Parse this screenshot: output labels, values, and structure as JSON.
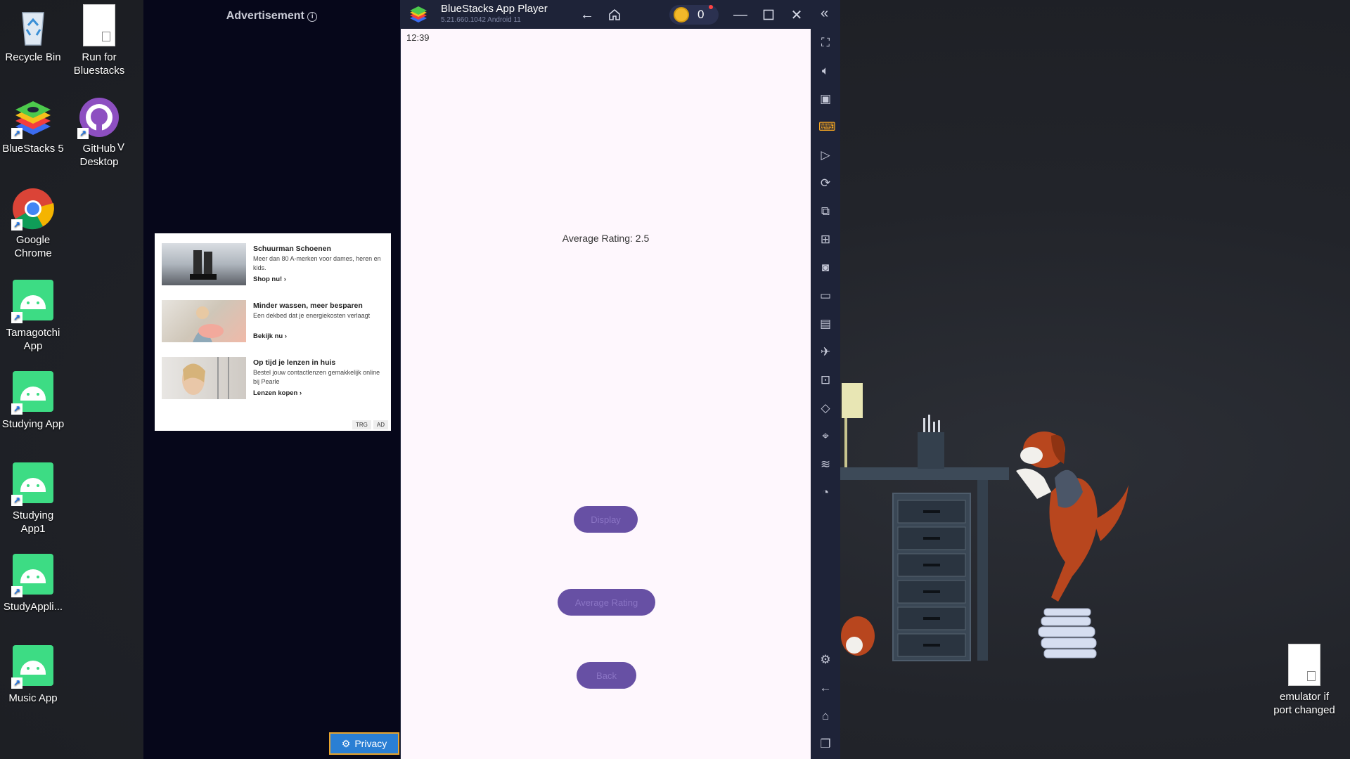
{
  "desktop": {
    "icons": [
      {
        "label": "Recycle Bin",
        "icon": "recycle-bin-icon"
      },
      {
        "label": "Run for\nBluestacks",
        "icon": "file-icon"
      },
      {
        "label": "BlueStacks 5",
        "icon": "bluestacks-icon"
      },
      {
        "label": "GitHub\nDesktop",
        "icon": "github-icon"
      },
      {
        "label": "V",
        "icon": ""
      },
      {
        "label": "Google\nChrome",
        "icon": "chrome-icon"
      },
      {
        "label": "Tamagotchi\nApp",
        "icon": "android-icon"
      },
      {
        "label": "Studying App",
        "icon": "android-icon"
      },
      {
        "label": "Studying\nApp1",
        "icon": "android-icon"
      },
      {
        "label": "StudyAppli...",
        "icon": "android-icon"
      },
      {
        "label": "Music App",
        "icon": "android-icon"
      },
      {
        "label": "emulator if\nport changed",
        "icon": "file-icon"
      }
    ]
  },
  "ad": {
    "header": "Advertisement",
    "items": [
      {
        "title": "Schuurman Schoenen",
        "desc": "Meer dan 80 A-merken voor dames, heren en kids.",
        "cta": "Shop nu!"
      },
      {
        "title": "Minder wassen, meer besparen",
        "desc": "Een dekbed dat je energiekosten verlaagt",
        "cta": "Bekijk nu"
      },
      {
        "title": "Op tijd je lenzen in huis",
        "desc": "Bestel jouw contactlenzen gemakkelijk online bij Pearle",
        "cta": "Lenzen kopen"
      }
    ],
    "badges": [
      "TRG",
      "AD"
    ],
    "privacy_label": "Privacy"
  },
  "bluestacks": {
    "title": "BlueStacks App Player",
    "version": "5.21.660.1042  Android 11",
    "coins": "0",
    "colors": {
      "frame": "#1e2338",
      "screen": "#fef7fd",
      "button": "#6750a4"
    }
  },
  "app": {
    "status_time": "12:39",
    "average_text": "Average Rating: 2.5",
    "buttons": {
      "display": "Display",
      "average": "Average Rating",
      "back": "Back"
    }
  }
}
